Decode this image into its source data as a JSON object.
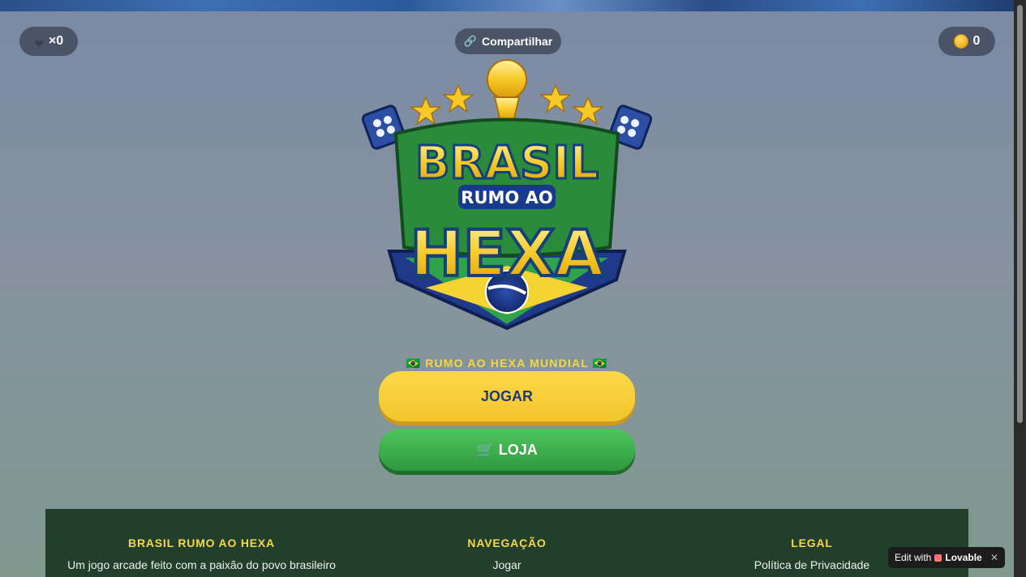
{
  "hud": {
    "lives_count": "×0",
    "share_label": "Compartilhar",
    "coins": "0"
  },
  "logo": {
    "line1": "BRASIL",
    "line2": "RUMO AO",
    "line3": "HEXA"
  },
  "tagline": "🇧🇷 RUMO AO HEXA MUNDIAL 🇧🇷",
  "buttons": {
    "play_label": "JOGAR",
    "shop_label": "🛒 LOJA"
  },
  "footer": {
    "col1_title": "BRASIL RUMO AO HEXA",
    "col1_text": "Um jogo arcade feito com a paixão do povo brasileiro",
    "col2_title": "NAVEGAÇÃO",
    "col2_link": "Jogar",
    "col3_title": "LEGAL",
    "col3_link": "Política de Privacidade"
  },
  "badge": {
    "prefix": "Edit with",
    "brand": "Lovable",
    "close": "✕"
  },
  "colors": {
    "accent_yellow": "#f5d84a",
    "brand_blue": "#1e3a7a",
    "brand_green": "#2e9a3f",
    "footer_bg": "#213f2a"
  }
}
